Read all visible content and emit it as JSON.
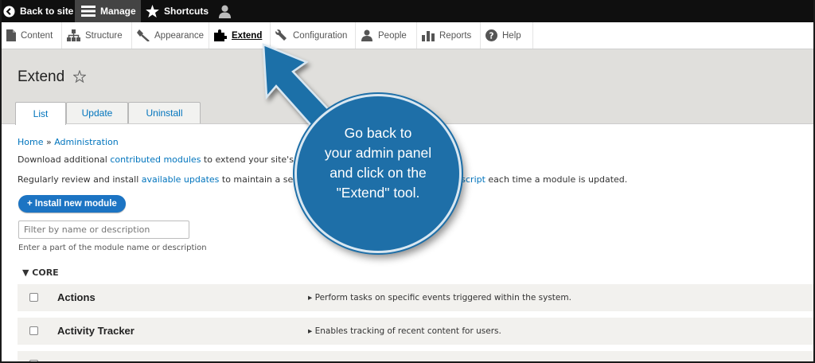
{
  "toolbar": {
    "back_label": "Back to site",
    "manage_label": "Manage",
    "shortcuts_label": "Shortcuts"
  },
  "tray": {
    "items": [
      {
        "label": "Content",
        "icon": "content-icon"
      },
      {
        "label": "Structure",
        "icon": "structure-icon"
      },
      {
        "label": "Appearance",
        "icon": "appearance-icon"
      },
      {
        "label": "Extend",
        "icon": "extend-icon",
        "active": true
      },
      {
        "label": "Configuration",
        "icon": "configuration-icon"
      },
      {
        "label": "People",
        "icon": "people-icon"
      },
      {
        "label": "Reports",
        "icon": "reports-icon"
      },
      {
        "label": "Help",
        "icon": "help-icon"
      }
    ]
  },
  "page": {
    "title": "Extend",
    "tabs": [
      "List",
      "Update",
      "Uninstall"
    ]
  },
  "content": {
    "breadcrumb_home": "Home",
    "breadcrumb_sep": " » ",
    "breadcrumb_admin": "Administration",
    "line1_pre": "Download additional ",
    "line1_link": "contributed modules",
    "line1_post": " to extend your site's fu",
    "line2_pre": "Regularly review and install ",
    "line2_link": "available updates",
    "line2_post": " to maintain a secure",
    "line2_link2": "e script",
    "line2_post2": " each time a module is updated.",
    "install_button": "+ Install new module",
    "filter_placeholder": "Filter by name or description",
    "filter_help": "Enter a part of the module name or description",
    "core_label": "▼ CORE"
  },
  "modules": [
    {
      "name": "Actions",
      "description": "▸ Perform tasks on specific events triggered within the system."
    },
    {
      "name": "Activity Tracker",
      "description": "▸ Enables tracking of recent content for users."
    }
  ],
  "callout": {
    "line1": "Go back to",
    "line2": "your admin panel",
    "line3": "and click on the",
    "line4": "\"Extend\" tool."
  },
  "colors": {
    "accent_blue": "#0074bd",
    "callout_blue": "#1e6fa8",
    "toolbar_bg": "#0f0f0f"
  }
}
